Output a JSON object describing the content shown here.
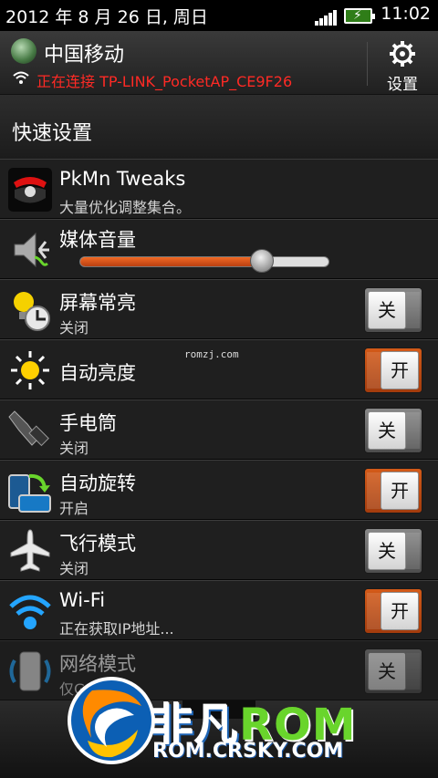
{
  "status_bar": {
    "date": "2012 年 8 月 26 日, 周日",
    "time": "11:02"
  },
  "carrier": {
    "name": "中国移动",
    "connection": "正在连接 TP-LINK_PocketAP_CE9F26",
    "settings_label": "设置"
  },
  "section": {
    "title": "快速设置"
  },
  "items": {
    "pkmn": {
      "title": "PkMn Tweaks",
      "subtitle": "大量优化调整集合。"
    },
    "media": {
      "title": "媒体音量",
      "level_percent": 73
    },
    "screen": {
      "title": "屏幕常亮",
      "subtitle": "关闭",
      "toggle": "关"
    },
    "brightness": {
      "title": "自动亮度",
      "toggle": "开"
    },
    "flashlight": {
      "title": "手电筒",
      "subtitle": "关闭",
      "toggle": "关"
    },
    "rotate": {
      "title": "自动旋转",
      "subtitle": "开启",
      "toggle": "开"
    },
    "airplane": {
      "title": "飞行模式",
      "subtitle": "关闭",
      "toggle": "关"
    },
    "wifi": {
      "title": "Wi-Fi",
      "subtitle": "正在获取IP地址...",
      "toggle": "开"
    },
    "network": {
      "title": "网络模式",
      "subtitle": "仅GSM",
      "toggle": "关"
    }
  },
  "watermark": "romzj.com",
  "brand": {
    "name_cn": "非凡",
    "name_en": "ROM",
    "url": "ROM.CRSKY.COM"
  },
  "colors": {
    "accent_orange": "#d45a18",
    "warning_red": "#ff2a25",
    "brand_green": "#69d52c",
    "brand_blue": "#1d63b4"
  },
  "icons": {
    "settings": "gear-icon",
    "wifi": "wifi-icon",
    "flashlight": "flashlight-icon",
    "airplane": "airplane-icon",
    "brightness": "sun-icon",
    "rotate": "rotate-icon",
    "network": "phone-network-icon",
    "media": "speaker-icon"
  }
}
